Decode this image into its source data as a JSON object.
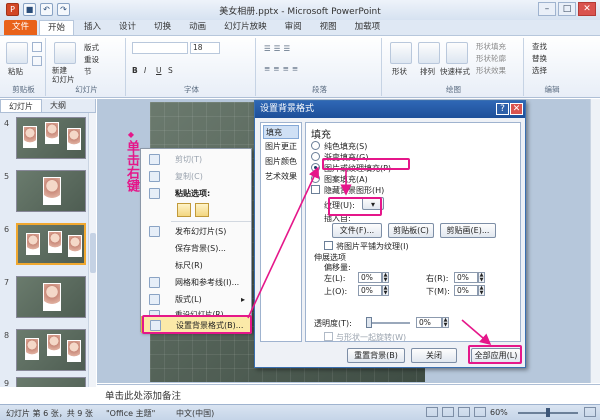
{
  "app": {
    "title": "美女相册.pptx - Microsoft PowerPoint",
    "tabs": [
      "文件",
      "开始",
      "插入",
      "设计",
      "切换",
      "动画",
      "幻灯片放映",
      "审阅",
      "视图",
      "加载项"
    ]
  },
  "ribbon": {
    "paste": "粘贴",
    "new_slide": "新建\n幻灯片",
    "layout": "版式",
    "reset": "重设",
    "section": "节",
    "font_size": "18",
    "shapes": "形状",
    "arrange": "排列",
    "quick_styles": "快速样式",
    "shape_fill": "形状填充",
    "shape_outline": "形状轮廓",
    "shape_effects": "形状效果",
    "find": "查找",
    "replace": "替换",
    "select": "选择",
    "groups": {
      "clipboard": "剪贴板",
      "slides": "幻灯片",
      "font": "字体",
      "paragraph": "段落",
      "drawing": "绘图",
      "editing": "编辑"
    }
  },
  "left_pane": {
    "tabs": [
      "幻灯片",
      "大纲"
    ],
    "slide_numbers": [
      "4",
      "5",
      "6",
      "7",
      "8",
      "9"
    ]
  },
  "annotation": {
    "vertical_text": "单击右键"
  },
  "context_menu": {
    "items": {
      "cut": "剪切(T)",
      "copy": "复制(C)",
      "paste_options": "粘贴选项:",
      "publish": "发布幻灯片(S)",
      "save_bg": "保存背景(S)...",
      "ruler": "标尺(R)",
      "grid": "网格和参考线(I)...",
      "layout": "版式(L)",
      "reset": "重设幻灯片(R)",
      "format_bg": "设置背景格式(B)..."
    }
  },
  "dialog": {
    "title": "设置背景格式",
    "nav": [
      "填充",
      "图片更正",
      "图片颜色",
      "艺术效果"
    ],
    "heading": "填充",
    "options": {
      "solid": "纯色填充(S)",
      "gradient": "渐变填充(G)",
      "picture": "图片或纹理填充(P)",
      "pattern": "图案填充(A)",
      "hide_bg": "隐藏背景图形(H)"
    },
    "texture_label": "纹理(U):",
    "insert_from": "插入自:",
    "file_btn": "文件(F)...",
    "clipboard_btn": "剪贴板(C)",
    "clipart_btn": "剪贴画(E)...",
    "tile_label": "将图片平铺为纹理(I)",
    "stretch_label": "伸展选项",
    "offset_label": "偏移量:",
    "left": "左(L):",
    "right": "右(R):",
    "top": "上(O):",
    "bottom": "下(M):",
    "offset_values": [
      "0%",
      "0%",
      "0%",
      "0%"
    ],
    "transparency_label": "透明度(T):",
    "transparency_value": "0%",
    "rotate_label": "与形状一起旋转(W)",
    "reset_btn": "重置背景(B)",
    "close_btn": "关闭",
    "apply_all_btn": "全部应用(L)"
  },
  "notes": {
    "placeholder": "单击此处添加备注"
  },
  "status": {
    "slide_info": "幻灯片 第 6 张，共 9 张",
    "theme": "\"Office 主题\"",
    "language": "中文(中国)",
    "zoom": "60%"
  }
}
